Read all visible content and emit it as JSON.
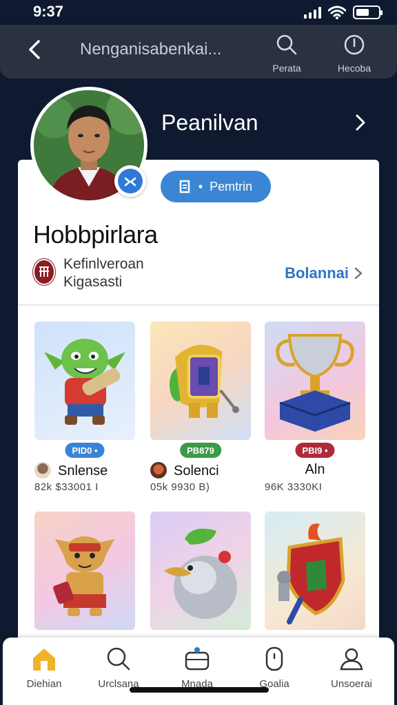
{
  "status": {
    "time": "9:37"
  },
  "nav": {
    "title": "Nenganisabenkai...",
    "search_label": "Perata",
    "history_label": "Hecoba"
  },
  "profile": {
    "name": "Peanilvan",
    "follow_label": "Pemtrin"
  },
  "card": {
    "title": "Hobbpirlara",
    "club_line1": "Kefinlveroan",
    "club_line2": "Kigasasti",
    "club_link": "Bolannai"
  },
  "items": [
    {
      "tag": "PID0 •",
      "tag_color": "#3a84d6",
      "name": "Snlense",
      "stats": "82k  $33001 I"
    },
    {
      "tag": "PB879",
      "tag_color": "#3c9a48",
      "name": "Solenci",
      "stats": "05k  9930 B)"
    },
    {
      "tag": "PBI9 •",
      "tag_color": "#b02a38",
      "name": "Aln",
      "stats": "96K  3330KI"
    },
    {
      "tag": "",
      "tag_color": "",
      "name": "",
      "stats": ""
    },
    {
      "tag": "",
      "tag_color": "",
      "name": "",
      "stats": ""
    },
    {
      "tag": "",
      "tag_color": "",
      "name": "",
      "stats": ""
    }
  ],
  "tabs": [
    {
      "label": "Diehian",
      "icon": "home-icon"
    },
    {
      "label": "Urclsana",
      "icon": "search-icon"
    },
    {
      "label": "Mnada",
      "icon": "bag-icon"
    },
    {
      "label": "Goalia",
      "icon": "device-icon"
    },
    {
      "label": "Unsoerai",
      "icon": "profile-icon"
    }
  ],
  "colors": {
    "accent": "#3b86d4",
    "active_tab": "#f0b429",
    "background": "#0f1a30"
  }
}
